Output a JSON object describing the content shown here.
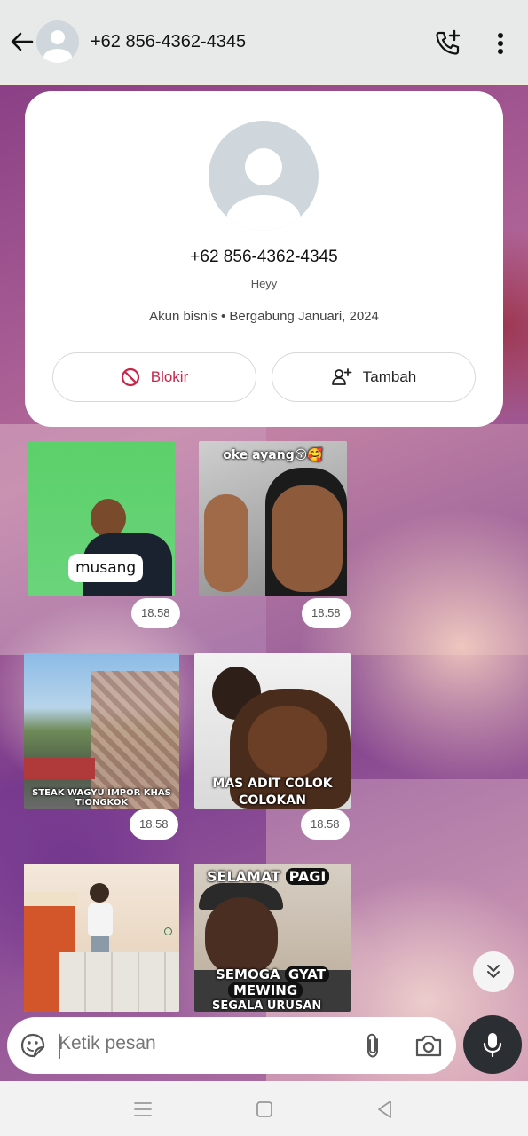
{
  "header": {
    "title": "+62 856-4362-4345",
    "back_icon": "arrow-back-icon",
    "call_icon": "add-call-icon",
    "menu_icon": "more-vertical-icon"
  },
  "profile": {
    "phone": "+62 856-4362-4345",
    "status": "Heyy",
    "meta": "Akun bisnis • Bergabung Januari, 2024",
    "block_label": "Blokir",
    "add_label": "Tambah"
  },
  "messages": [
    {
      "caption": "musang",
      "time": "18.58"
    },
    {
      "caption": "oke ayang😚🥰",
      "time": "18.58"
    },
    {
      "caption": "STEAK WAGYU IMPOR KHAS TIONGKOK",
      "time": "18.58"
    },
    {
      "caption": "MAS ADIT COLOK COLOKAN",
      "time": "18.58"
    },
    {
      "caption": "",
      "time": ""
    },
    {
      "caption_top": "SELAMAT",
      "caption_top_box": "PAGI",
      "caption_mid": "SEMOGA",
      "caption_mid_box": "GYAT",
      "caption_box2": "MEWING",
      "caption_bottom": "SEGALA URUSAN",
      "time": ""
    }
  ],
  "composer": {
    "placeholder": "Ketik pesan"
  },
  "colors": {
    "accent_red": "#c8254a",
    "caret_green": "#1aa36e",
    "mic_bg": "#2b2f33"
  }
}
